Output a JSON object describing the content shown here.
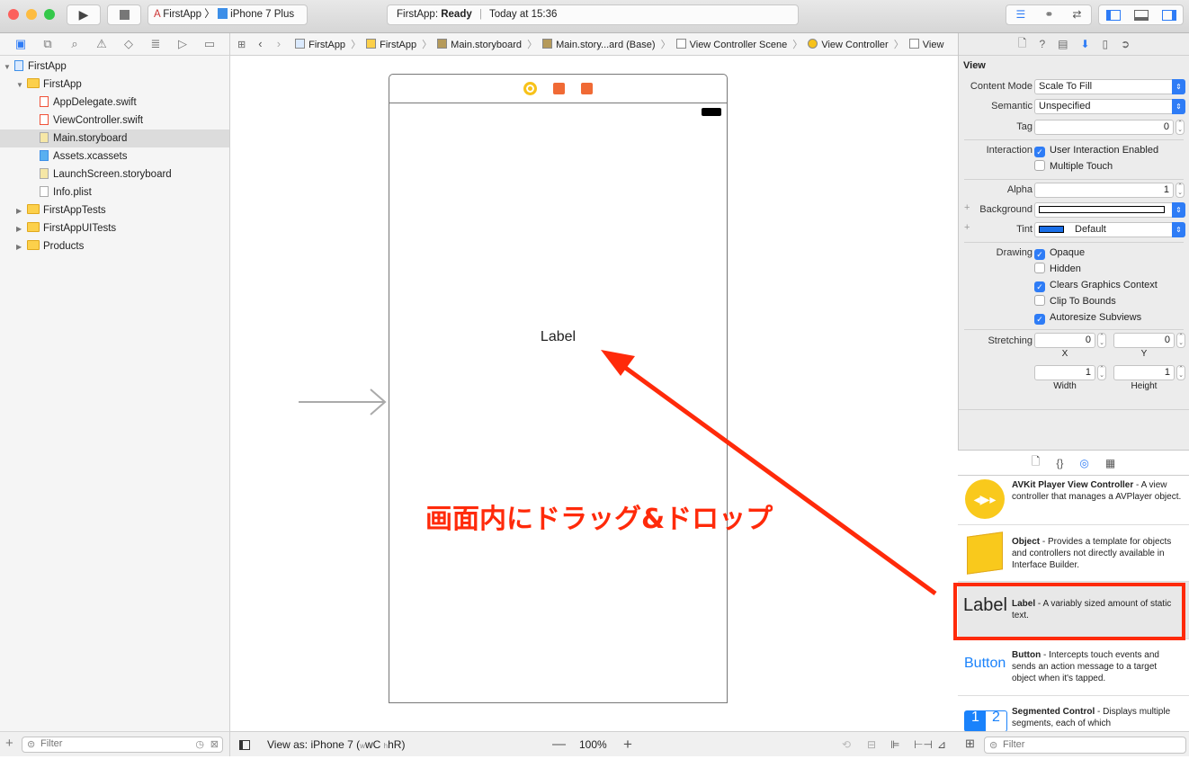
{
  "toolbar": {
    "scheme": "FirstApp",
    "device": "iPhone 7 Plus",
    "status_app": "FirstApp:",
    "status_state": "Ready",
    "status_time": "Today at 15:36"
  },
  "navigator": {
    "items": [
      {
        "label": "FirstApp",
        "level": 0,
        "type": "project",
        "open": true
      },
      {
        "label": "FirstApp",
        "level": 1,
        "type": "folder",
        "open": true
      },
      {
        "label": "AppDelegate.swift",
        "level": 2,
        "type": "swift"
      },
      {
        "label": "ViewController.swift",
        "level": 2,
        "type": "swift"
      },
      {
        "label": "Main.storyboard",
        "level": 2,
        "type": "storyboard",
        "selected": true
      },
      {
        "label": "Assets.xcassets",
        "level": 2,
        "type": "assets"
      },
      {
        "label": "LaunchScreen.storyboard",
        "level": 2,
        "type": "storyboard"
      },
      {
        "label": "Info.plist",
        "level": 2,
        "type": "plist"
      },
      {
        "label": "FirstAppTests",
        "level": 1,
        "type": "folder",
        "open": false
      },
      {
        "label": "FirstAppUITests",
        "level": 1,
        "type": "folder",
        "open": false
      },
      {
        "label": "Products",
        "level": 1,
        "type": "folder",
        "open": false
      }
    ],
    "filter_placeholder": "Filter"
  },
  "jumpbar": [
    "FirstApp",
    "FirstApp",
    "Main.storyboard",
    "Main.story...ard (Base)",
    "View Controller Scene",
    "View Controller",
    "View"
  ],
  "canvas": {
    "label_text": "Label",
    "annotation": "画面内にドラッグ&ドロップ",
    "annotation_color": "#ff2a0a"
  },
  "bottombar": {
    "view_as": "View as: iPhone 7 (",
    "wc": "wC",
    "hr": "hR",
    "close": ")",
    "zoom": "100%"
  },
  "inspector": {
    "section": "View",
    "content_mode_label": "Content Mode",
    "content_mode": "Scale To Fill",
    "semantic_label": "Semantic",
    "semantic": "Unspecified",
    "tag_label": "Tag",
    "tag": "0",
    "interaction_label": "Interaction",
    "user_interaction": "User Interaction Enabled",
    "multiple_touch": "Multiple Touch",
    "alpha_label": "Alpha",
    "alpha": "1",
    "background_label": "Background",
    "tint_label": "Tint",
    "tint": "Default",
    "tint_color": "#1a6fe8",
    "drawing_label": "Drawing",
    "opaque": "Opaque",
    "hidden": "Hidden",
    "clears": "Clears Graphics Context",
    "clip": "Clip To Bounds",
    "autoresize": "Autoresize Subviews",
    "stretching_label": "Stretching",
    "x": "0",
    "y": "0",
    "width": "1",
    "height": "1",
    "x_label": "X",
    "y_label": "Y",
    "width_label": "Width",
    "height_label": "Height"
  },
  "library": {
    "items": [
      {
        "title": "AVKit Player View Controller",
        "desc": " - A view controller that manages a AVPlayer object."
      },
      {
        "title": "Object",
        "desc": " - Provides a template for objects and controllers not directly available in Interface Builder."
      },
      {
        "title": "Label",
        "desc": " - A variably sized amount of static text.",
        "preview": "Label"
      },
      {
        "title": "Button",
        "desc": " - Intercepts touch events and sends an action message to a target object when it's tapped.",
        "preview": "Button"
      },
      {
        "title": "Segmented Control",
        "desc": " - Displays multiple segments, each of which",
        "preview1": "1",
        "preview2": "2"
      }
    ],
    "filter_placeholder": "Filter"
  }
}
